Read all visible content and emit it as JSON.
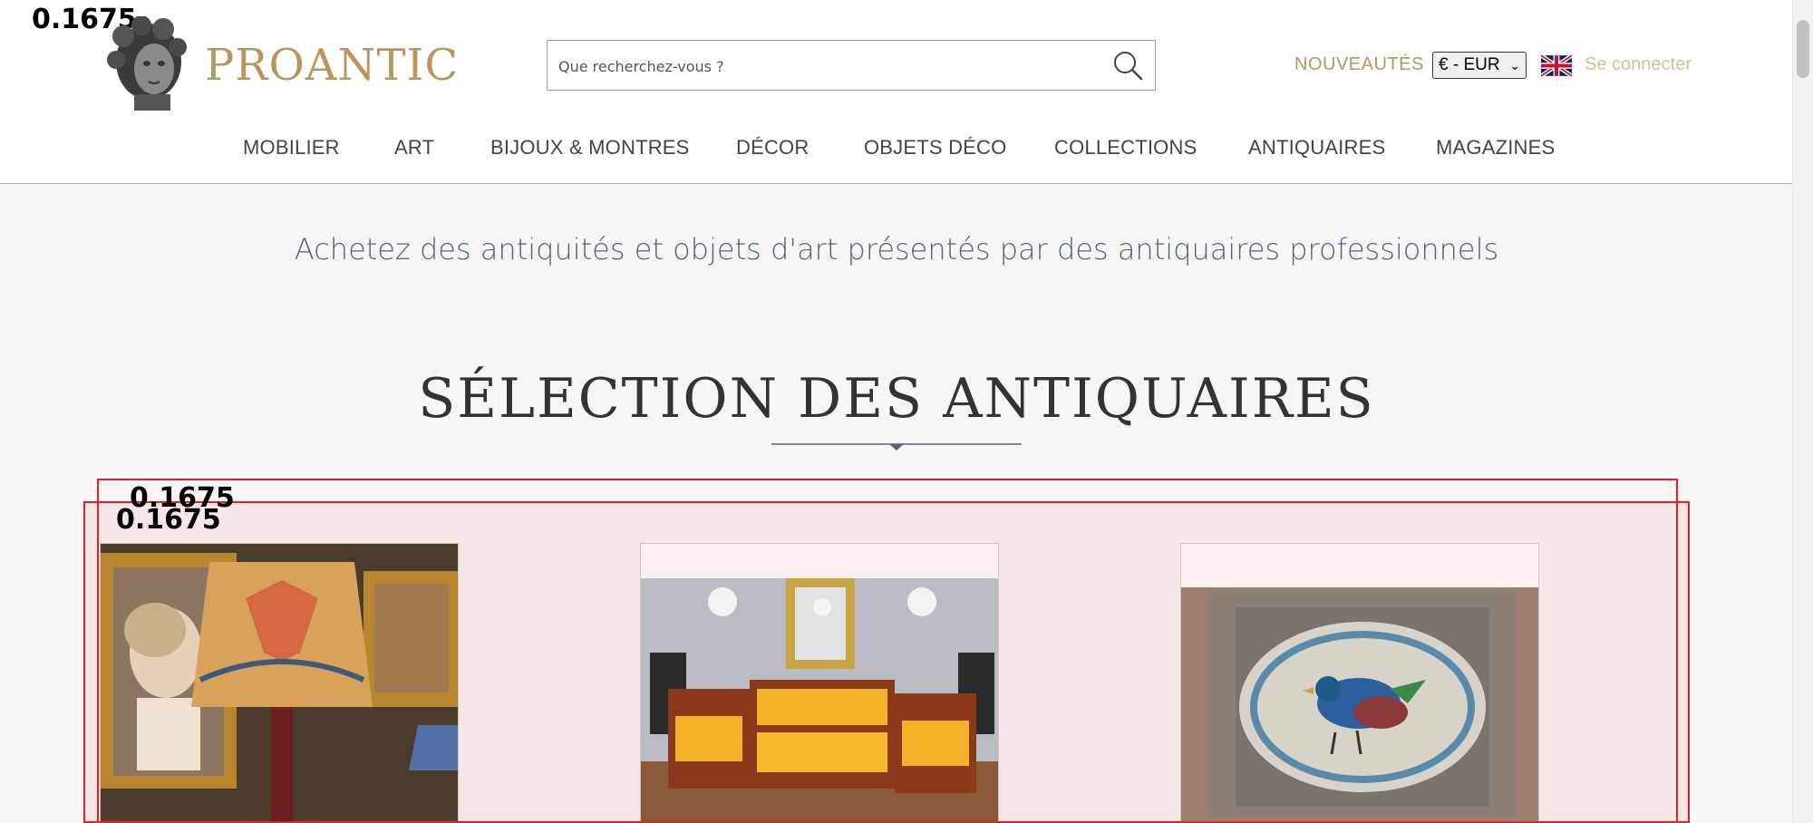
{
  "header": {
    "logo_text": "PROANTIC",
    "search_placeholder": "Que recherchez-vous ?",
    "new_label": "NOUVEAUTÉS",
    "currency_value": "€ - EUR",
    "login_label": "Se connecter"
  },
  "nav": {
    "items": [
      "MOBILIER",
      "ART",
      "BIJOUX & MONTRES",
      "DÉCOR",
      "OBJETS DÉCO",
      "COLLECTIONS",
      "ANTIQUAIRES",
      "MAGAZINES"
    ]
  },
  "main": {
    "tagline": "Achetez des antiquités et objets d'art présentés par des antiquaires professionnels",
    "section_title": "SÉLECTION DES ANTIQUAIRES",
    "cards": [
      {
        "name": "card-portrait-lamp"
      },
      {
        "name": "card-empire-salon"
      },
      {
        "name": "card-bird-plate"
      }
    ]
  },
  "overlays": {
    "score_top": "0.1675",
    "score_a": "0.1675",
    "score_b": "0.1675"
  },
  "colors": {
    "brand_gold": "#b9965b",
    "tagline_blue": "#4d6582",
    "carousel_pink": "#f6e6e6",
    "outline_red": "#e82020"
  }
}
